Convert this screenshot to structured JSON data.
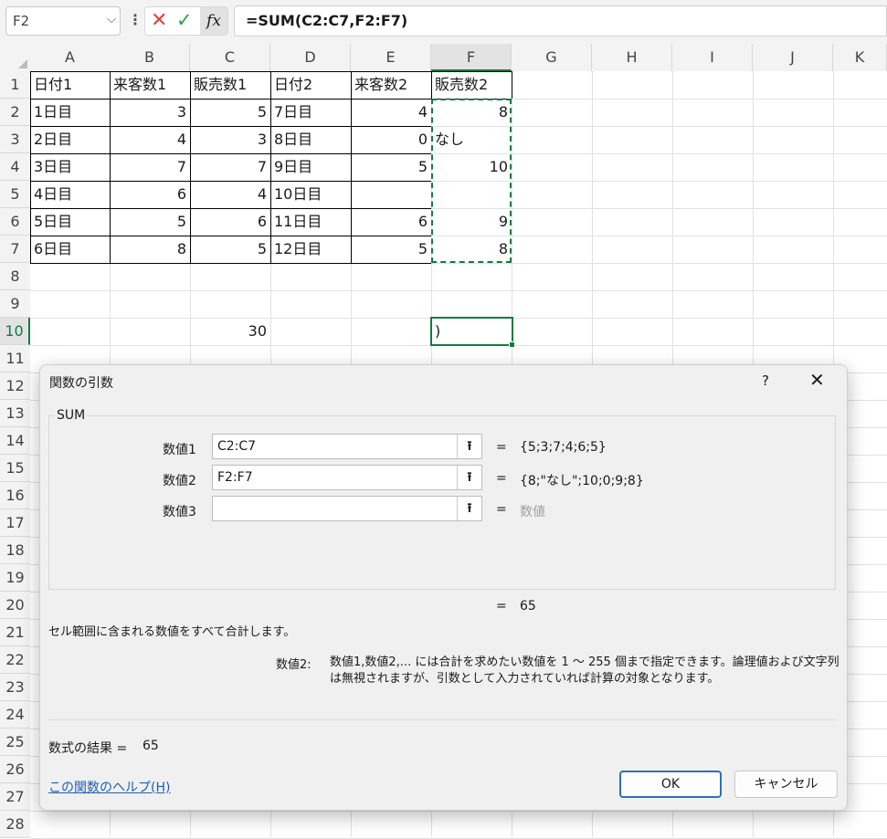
{
  "formula_bar": {
    "name_box": "F2",
    "formula_prefix": "=SUM(",
    "formula_args": "C2:C7,F2:F7",
    "formula_suffix": ")",
    "cancel_glyph": "✕",
    "enter_glyph": "✓",
    "fx_label": "fx"
  },
  "columns": [
    "A",
    "B",
    "C",
    "D",
    "E",
    "F",
    "G",
    "H",
    "I",
    "J",
    "K"
  ],
  "rows": [
    "1",
    "2",
    "3",
    "4",
    "5",
    "6",
    "7",
    "8",
    "9",
    "10",
    "11",
    "12",
    "13",
    "14",
    "15",
    "16",
    "17",
    "18",
    "19",
    "20",
    "21",
    "22",
    "23",
    "24",
    "25",
    "26",
    "27",
    "28"
  ],
  "cells": {
    "A1": "日付1",
    "B1": "来客数1",
    "C1": "販売数1",
    "D1": "日付2",
    "E1": "来客数2",
    "F1": "販売数2",
    "A2": "1日目",
    "B2": "3",
    "C2": "5",
    "D2": "7日目",
    "E2": "4",
    "F2": "8",
    "A3": "2日目",
    "B3": "4",
    "C3": "3",
    "D3": "8日目",
    "E3": "0",
    "F3": "なし",
    "A4": "3日目",
    "B4": "7",
    "C4": "7",
    "D4": "9日目",
    "E4": "5",
    "F4": "10",
    "A5": "4日目",
    "B5": "6",
    "C5": "4",
    "D5": "10日目",
    "E5": "",
    "F5": "",
    "A6": "5日目",
    "B6": "5",
    "C6": "6",
    "D6": "11日目",
    "E6": "6",
    "F6": "9",
    "A7": "6日目",
    "B7": "8",
    "C7": "5",
    "D7": "12日目",
    "E7": "5",
    "F7": "8",
    "C10": "30",
    "F10": ")"
  },
  "dialog": {
    "title": "関数の引数",
    "help_glyph": "?",
    "close_glyph": "✕",
    "function_name": "SUM",
    "args": [
      {
        "label": "数値1",
        "value": "C2:C7",
        "result": "{5;3;7;4;6;5}"
      },
      {
        "label": "数値2",
        "value": "F2:F7",
        "result": "{8;\"なし\";10;0;9;8}"
      },
      {
        "label": "数値3",
        "value": "",
        "result": "数値"
      }
    ],
    "equals": "=",
    "upload_glyph": "⭱",
    "total": "65",
    "description": "セル範囲に含まれる数値をすべて合計します。",
    "arg_name": "数値2:",
    "arg_description": "数値1,数値2,... には合計を求めたい数値を 1 ～ 255 個まで指定できます。論理値および文字列は無視されますが、引数として入力されていれば計算の対象となります。",
    "result_label": "数式の結果 =",
    "result_value": "65",
    "help_link": "この関数のヘルプ(H)",
    "ok_label": "OK",
    "cancel_label": "キャンセル"
  },
  "colors": {
    "selection": "#107c41",
    "link": "#1a5fb4",
    "ok_border": "#2e6fb7"
  }
}
